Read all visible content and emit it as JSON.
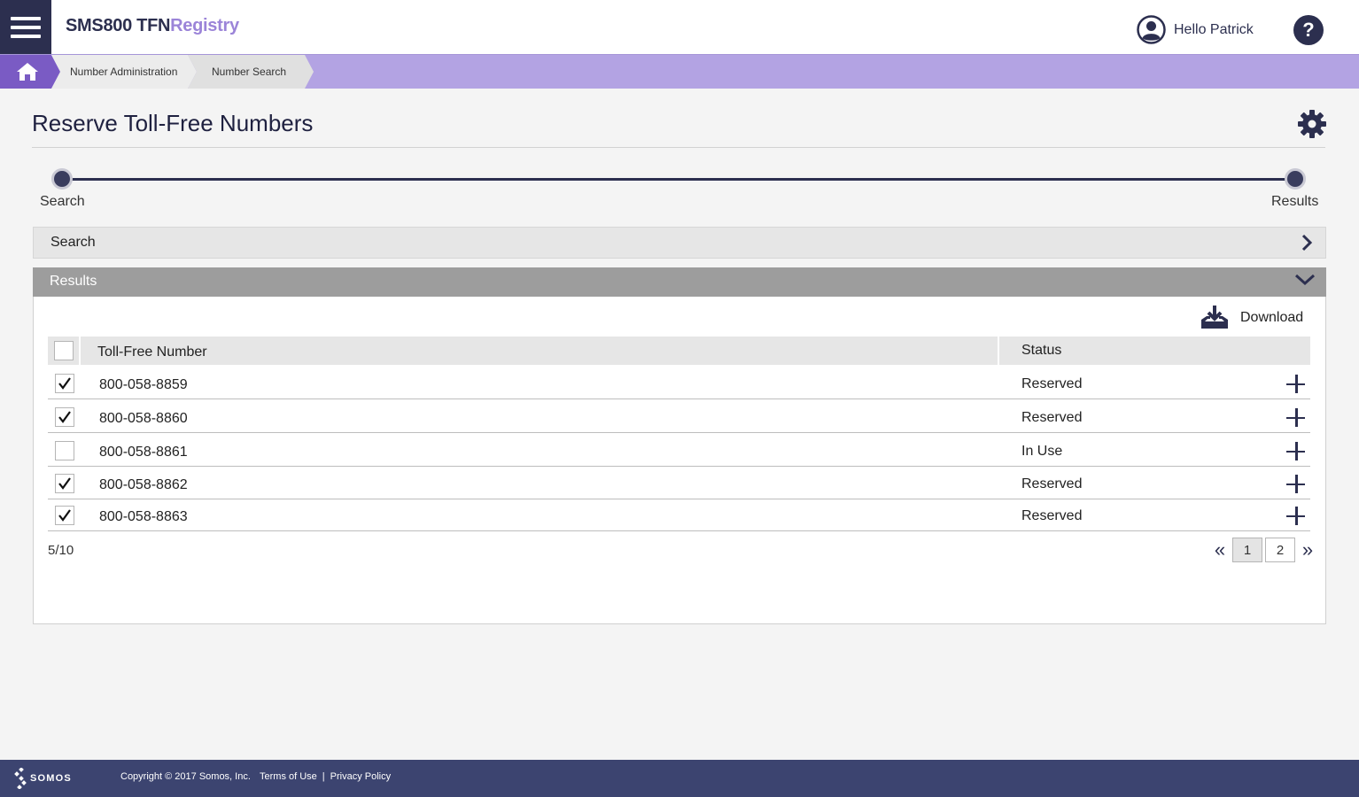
{
  "header": {
    "brand_main": "SMS800 TFN",
    "brand_accent": "Registry",
    "greeting": "Hello Patrick",
    "help_label": "?"
  },
  "breadcrumb": {
    "items": [
      "Number Administration",
      "Number Search"
    ]
  },
  "page": {
    "title": "Reserve Toll-Free Numbers"
  },
  "stepper": {
    "steps": [
      "Search",
      "Results"
    ]
  },
  "panels": {
    "search_label": "Search",
    "results_label": "Results"
  },
  "results": {
    "download_label": "Download",
    "columns": [
      "Toll-Free Number",
      "Status"
    ],
    "rows": [
      {
        "number": "800-058-8859",
        "status": "Reserved",
        "checked": true
      },
      {
        "number": "800-058-8860",
        "status": "Reserved",
        "checked": true
      },
      {
        "number": "800-058-8861",
        "status": "In Use",
        "checked": false
      },
      {
        "number": "800-058-8862",
        "status": "Reserved",
        "checked": true
      },
      {
        "number": "800-058-8863",
        "status": "Reserved",
        "checked": true
      }
    ],
    "count": "5/10",
    "pages": [
      "1",
      "2"
    ],
    "current_page": "1"
  },
  "footer": {
    "logo_text": "SOMOS",
    "copyright": "Copyright © 2017 Somos, Inc.",
    "terms": "Terms of Use",
    "separator": "|",
    "privacy": "Privacy Policy"
  },
  "colors": {
    "navy": "#2c2f4f",
    "purple": "#7a5bc4",
    "lavender": "#b3a3e3",
    "accent": "#9b84d8",
    "footer": "#3c4470"
  },
  "icons": [
    "menu-icon",
    "user-icon",
    "help-icon",
    "home-icon",
    "gear-icon",
    "chevron-right-icon",
    "chevron-down-icon",
    "download-icon",
    "checkmark-icon",
    "plus-icon",
    "double-chevron-left-icon",
    "double-chevron-right-icon",
    "somos-logo-icon"
  ]
}
